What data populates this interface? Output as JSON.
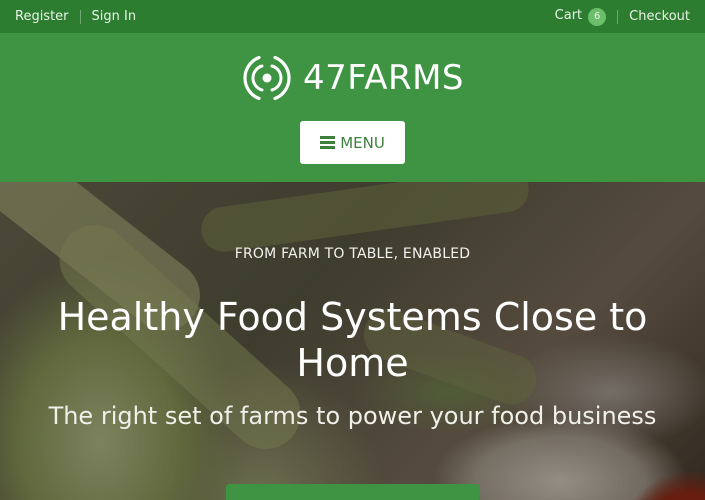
{
  "topbar": {
    "register": "Register",
    "sign_in": "Sign In",
    "cart": "Cart",
    "cart_count": "6",
    "checkout": "Checkout"
  },
  "header": {
    "brand": "47FARMS",
    "menu_label": "MENU"
  },
  "hero": {
    "eyebrow": "FROM FARM TO TABLE, ENABLED",
    "headline": "Healthy Food Systems Close to Home",
    "subheadline": "The right set of farms to power your food business"
  },
  "colors": {
    "topbar": "#2d7d31",
    "header": "#3e9442",
    "menu_text": "#3e7f3e",
    "badge": "#6bbf6a"
  },
  "icons": {
    "logo": "concentric-circles-icon",
    "menu": "hamburger-icon"
  }
}
